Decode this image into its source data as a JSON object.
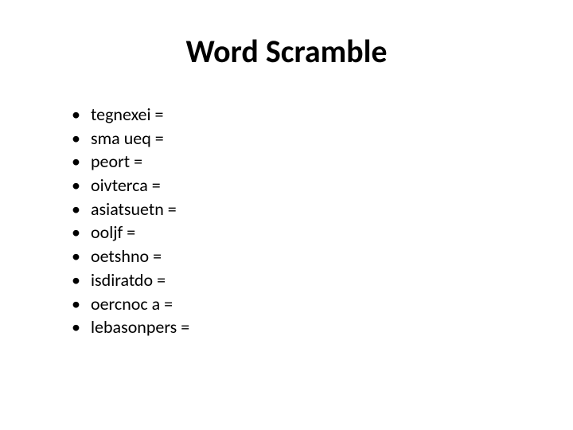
{
  "title": "Word Scramble",
  "items": [
    "tegnexei =",
    "sma ueq =",
    "peort =",
    "oivterca =",
    "asiatsuetn =",
    "ooljf =",
    "oetshno =",
    "isdiratdo =",
    "oercnoc a =",
    "lebasonpers ="
  ]
}
